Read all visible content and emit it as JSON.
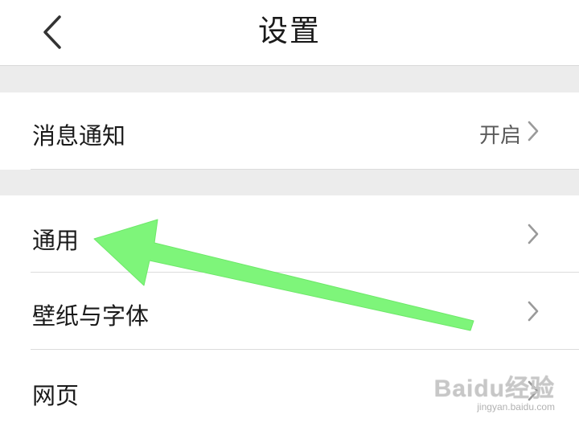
{
  "header": {
    "title": "设置",
    "back_icon": "chevron-left-icon"
  },
  "settings": {
    "notifications": {
      "label": "消息通知",
      "value": "开启",
      "icon": "chevron-right-icon"
    },
    "general": {
      "label": "通用",
      "icon": "chevron-right-icon"
    },
    "wallpaper_font": {
      "label": "壁纸与字体",
      "icon": "chevron-right-icon"
    },
    "webpage": {
      "label": "网页",
      "icon": "chevron-right-icon"
    }
  },
  "annotation": {
    "type": "arrow",
    "color": "#7ef57a",
    "points_to": "general"
  },
  "watermark": {
    "logo": "Baidu经验",
    "site": "jingyan.baidu.com"
  },
  "colors": {
    "background": "#ffffff",
    "section_gap": "#ececec",
    "divider": "#dcdcdc",
    "chevron": "#9a9a9a",
    "text_primary": "#1a1a1a",
    "text_secondary": "#5a5a5a"
  }
}
